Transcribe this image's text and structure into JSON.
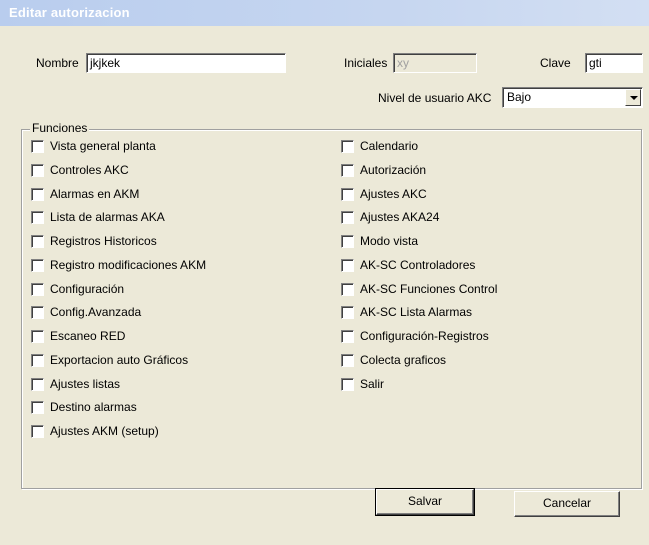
{
  "window": {
    "title": "Editar autorizacion"
  },
  "form": {
    "nombre_label": "Nombre",
    "nombre_value": "jkjkek",
    "iniciales_label": "Iniciales",
    "iniciales_value": "xy",
    "clave_label": "Clave",
    "clave_value": "gti",
    "nivel_label": "Nivel de usuario AKC",
    "nivel_value": "Bajo"
  },
  "funciones": {
    "label": "Funciones",
    "left": [
      {
        "label": "Vista general planta",
        "checked": false
      },
      {
        "label": "Controles AKC",
        "checked": false
      },
      {
        "label": "Alarmas en AKM",
        "checked": false
      },
      {
        "label": "Lista de alarmas AKA",
        "checked": false
      },
      {
        "label": "Registros Historicos",
        "checked": false
      },
      {
        "label": "Registro modificaciones AKM",
        "checked": false
      },
      {
        "label": "Configuración",
        "checked": false
      },
      {
        "label": "Config.Avanzada",
        "checked": false
      },
      {
        "label": "Escaneo RED",
        "checked": false
      },
      {
        "label": "Exportacion auto Gráficos",
        "checked": false
      },
      {
        "label": "Ajustes listas",
        "checked": false
      },
      {
        "label": "Destino alarmas",
        "checked": false
      },
      {
        "label": "Ajustes AKM (setup)",
        "checked": false
      }
    ],
    "right": [
      {
        "label": "Calendario",
        "checked": false
      },
      {
        "label": "Autorización",
        "checked": false
      },
      {
        "label": "Ajustes AKC",
        "checked": false
      },
      {
        "label": "Ajustes AKA24",
        "checked": false
      },
      {
        "label": "Modo vista",
        "checked": false
      },
      {
        "label": "AK-SC Controladores",
        "checked": false
      },
      {
        "label": "AK-SC Funciones Control",
        "checked": false
      },
      {
        "label": "AK-SC Lista Alarmas",
        "checked": false
      },
      {
        "label": "Configuración-Registros",
        "checked": false
      },
      {
        "label": "Colecta graficos",
        "checked": false
      },
      {
        "label": "Salir",
        "checked": false
      }
    ]
  },
  "buttons": {
    "save": "Salvar",
    "cancel": "Cancelar"
  }
}
